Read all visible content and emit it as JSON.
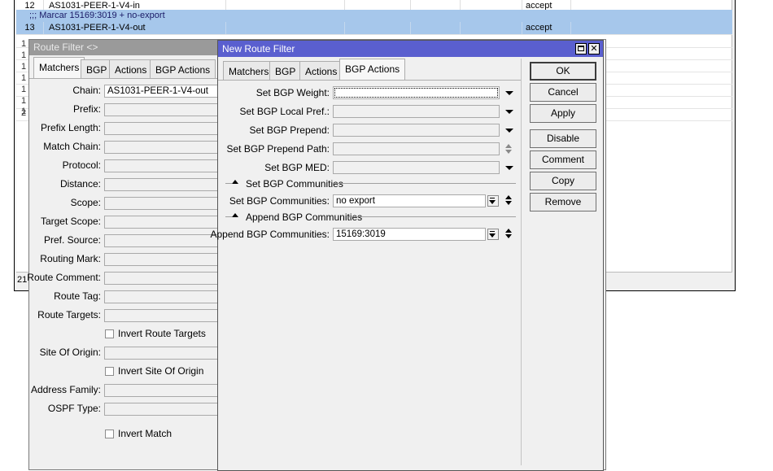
{
  "background_list": {
    "rows": [
      {
        "num": "12",
        "name": "AS1031-PEER-1-V4-in",
        "action": "accept"
      },
      {
        "comment": ";;; Marcar 15169:3019 + no-export"
      },
      {
        "num": "13",
        "name": "AS1031-PEER-1-V4-out",
        "action": "accept"
      }
    ],
    "gutter_glyphs": [
      "1",
      "1",
      "1",
      "1",
      "1",
      "1",
      "1",
      "2"
    ],
    "footer_count": "21"
  },
  "route_filter": {
    "title": "Route Filter <>",
    "tabs": [
      "Matchers",
      "BGP",
      "Actions",
      "BGP Actions"
    ],
    "labels": {
      "chain": "Chain:",
      "prefix": "Prefix:",
      "prefix_length": "Prefix Length:",
      "match_chain": "Match Chain:",
      "protocol": "Protocol:",
      "distance": "Distance:",
      "scope": "Scope:",
      "target_scope": "Target Scope:",
      "pref_source": "Pref. Source:",
      "routing_mark": "Routing Mark:",
      "route_comment": "Route Comment:",
      "route_tag": "Route Tag:",
      "route_targets": "Route Targets:",
      "site_of_origin": "Site Of Origin:",
      "address_family": "Address Family:",
      "ospf_type": "OSPF Type:"
    },
    "chain_value": "AS1031-PEER-1-V4-out",
    "checkboxes": {
      "invert_route_targets": "Invert Route Targets",
      "invert_site_of_origin": "Invert Site Of Origin",
      "invert_match": "Invert Match"
    }
  },
  "new_route_filter": {
    "title": "New Route Filter",
    "tabs": [
      "Matchers",
      "BGP",
      "Actions",
      "BGP Actions"
    ],
    "labels": {
      "weight": "Set BGP Weight:",
      "local_pref": "Set BGP Local Pref.:",
      "prepend": "Set BGP Prepend:",
      "prepend_path": "Set BGP Prepend Path:",
      "med": "Set BGP MED:",
      "communities_section": "Set BGP Communities",
      "communities": "Set BGP Communities:",
      "append_section": "Append BGP Communities",
      "append_communities": "Append BGP Communities:"
    },
    "values": {
      "weight": "",
      "local_pref": "",
      "prepend": "",
      "prepend_path": "",
      "med": "",
      "communities": "no export",
      "append_communities": "15169:3019"
    },
    "buttons": {
      "ok": "OK",
      "cancel": "Cancel",
      "apply": "Apply",
      "disable": "Disable",
      "comment": "Comment",
      "copy": "Copy",
      "remove": "Remove"
    }
  },
  "colors": {
    "active_title": "#5a5fcf",
    "inactive_title": "#9a9a9a",
    "selection": "#a6c7eb"
  }
}
